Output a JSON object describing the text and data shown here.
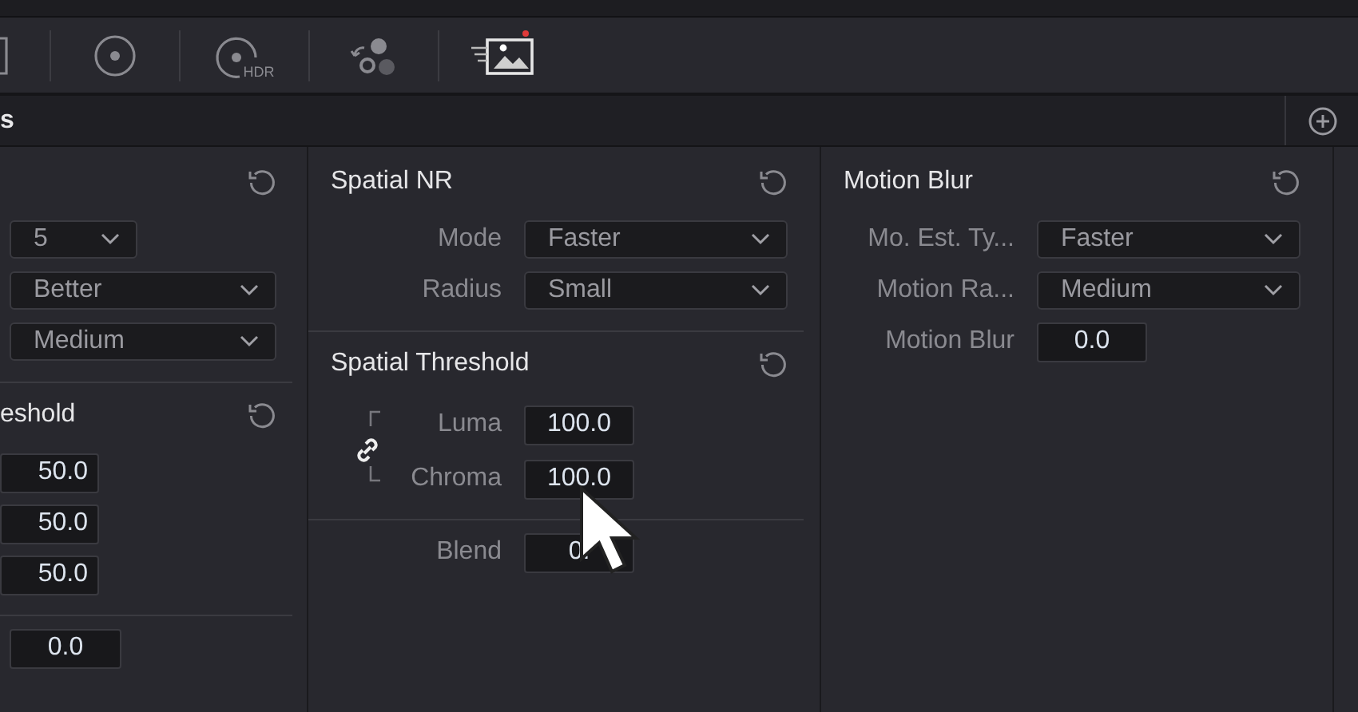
{
  "toolbar": {
    "hdr_label": "HDR",
    "badge": true
  },
  "header": {
    "title": "s"
  },
  "columns": [
    {
      "sections": [
        {
          "reset": true,
          "rows": [
            {
              "kind": "short-dropdown",
              "value": "5"
            },
            {
              "kind": "dropdown",
              "value": "Better"
            },
            {
              "kind": "dropdown",
              "value": "Medium"
            }
          ]
        },
        {
          "title": "eshold",
          "reset": true,
          "rows": [
            {
              "kind": "field",
              "value": "50.0"
            },
            {
              "kind": "field",
              "value": "50.0"
            },
            {
              "kind": "field",
              "value": "50.0"
            }
          ]
        },
        {
          "rows": [
            {
              "kind": "field",
              "value": "0.0"
            }
          ]
        }
      ]
    },
    {
      "sections": [
        {
          "title": "Spatial NR",
          "reset": true,
          "rows": [
            {
              "kind": "dropdown",
              "label": "Mode",
              "value": "Faster"
            },
            {
              "kind": "dropdown",
              "label": "Radius",
              "value": "Small"
            }
          ]
        },
        {
          "title": "Spatial Threshold",
          "reset": true,
          "rows": [
            {
              "kind": "linked",
              "fields": [
                {
                  "label": "Luma",
                  "value": "100.0"
                },
                {
                  "label": "Chroma",
                  "value": "100.0"
                }
              ]
            }
          ]
        },
        {
          "rows": [
            {
              "kind": "field",
              "label": "Blend",
              "value": "0."
            }
          ]
        }
      ]
    },
    {
      "sections": [
        {
          "title": "Motion Blur",
          "reset": true,
          "rows": [
            {
              "kind": "dropdown",
              "label": "Mo. Est. Ty...",
              "value": "Faster"
            },
            {
              "kind": "dropdown",
              "label": "Motion Ra...",
              "value": "Medium"
            },
            {
              "kind": "field",
              "label": "Motion Blur",
              "value": "0.0"
            }
          ]
        }
      ]
    }
  ]
}
